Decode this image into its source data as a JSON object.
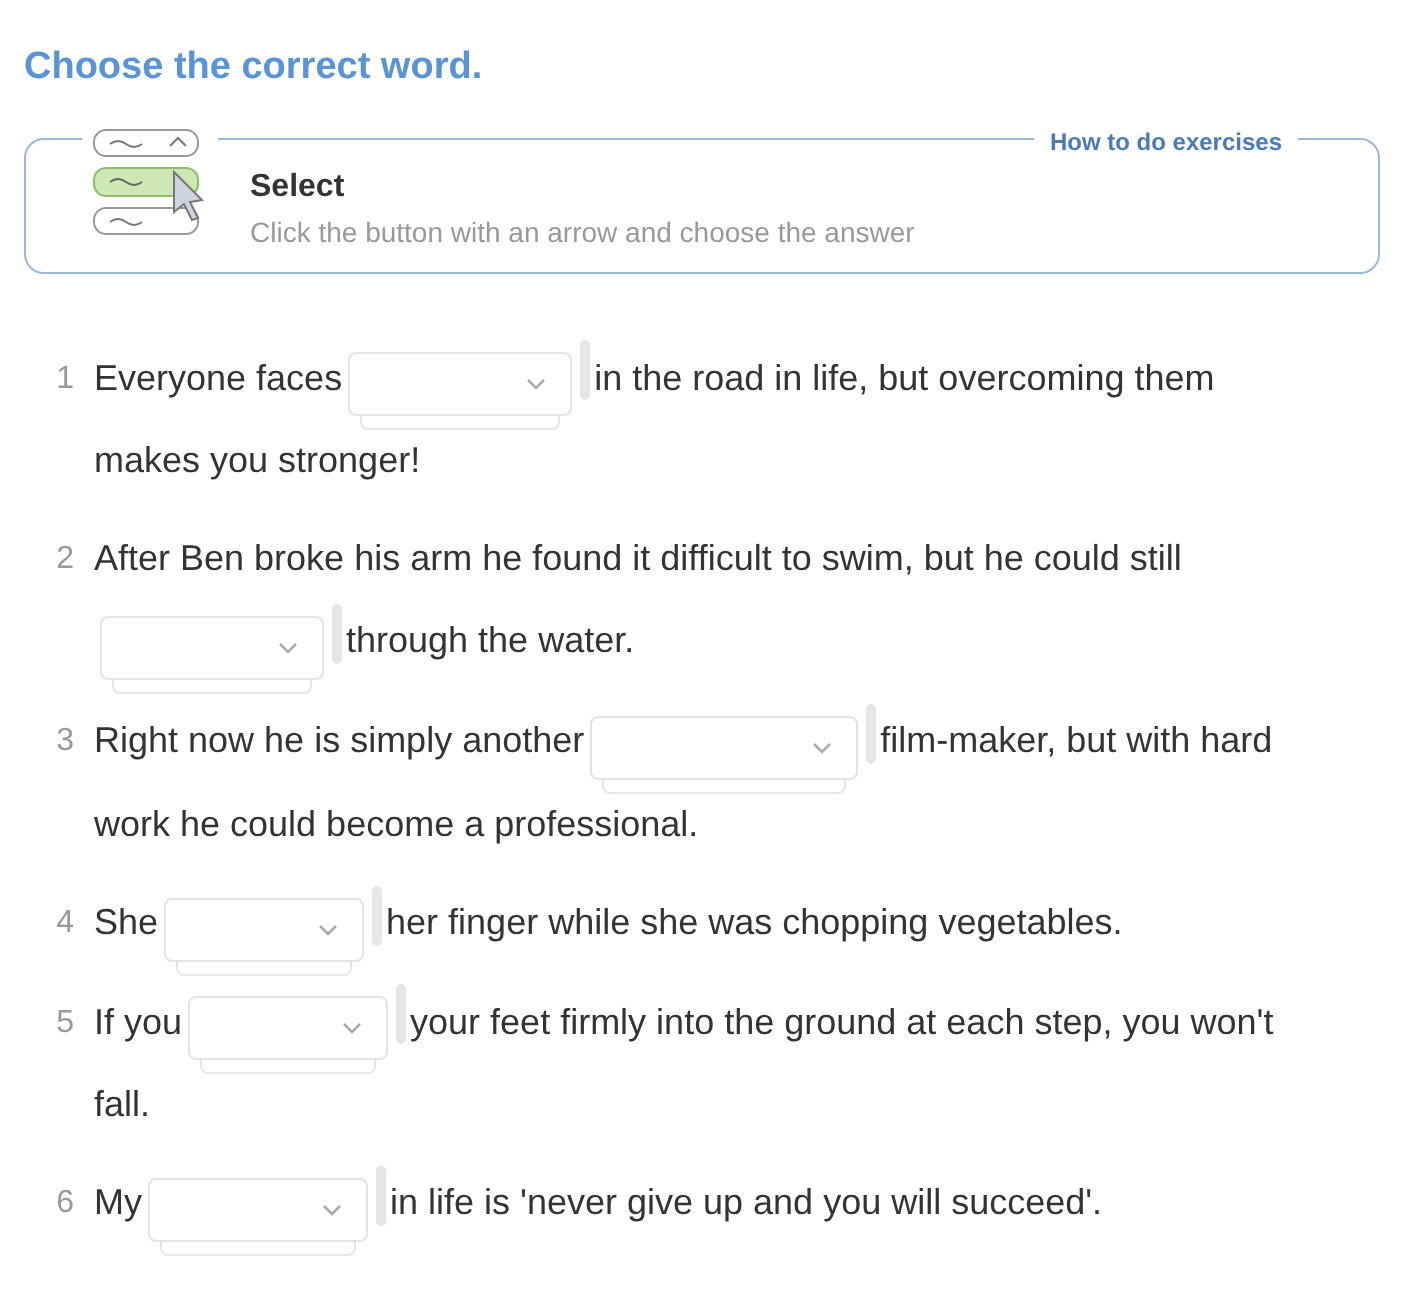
{
  "title": "Choose the correct word.",
  "instructions": {
    "legend": "How to do exercises",
    "heading": "Select",
    "text": "Click the button with an arrow and choose the answer"
  },
  "items": [
    {
      "number": "1",
      "before": "Everyone faces",
      "after": [
        "in the road in life, but overcoming them",
        "makes you stronger!"
      ]
    },
    {
      "number": "2",
      "before": "After Ben broke his arm he found it difficult to swim, but he could still",
      "after": [
        "through the water."
      ]
    },
    {
      "number": "3",
      "before": "Right now he is simply another",
      "after": [
        "film-maker, but with hard",
        "work he could become a professional."
      ]
    },
    {
      "number": "4",
      "before": "She",
      "after": [
        "her finger while she was chopping vegetables."
      ]
    },
    {
      "number": "5",
      "before": "If you",
      "after": [
        "your feet firmly into the ground at each step, you won't",
        "fall."
      ]
    },
    {
      "number": "6",
      "before": "My",
      "after": [
        "in life is 'never give up and you will succeed'."
      ]
    }
  ]
}
